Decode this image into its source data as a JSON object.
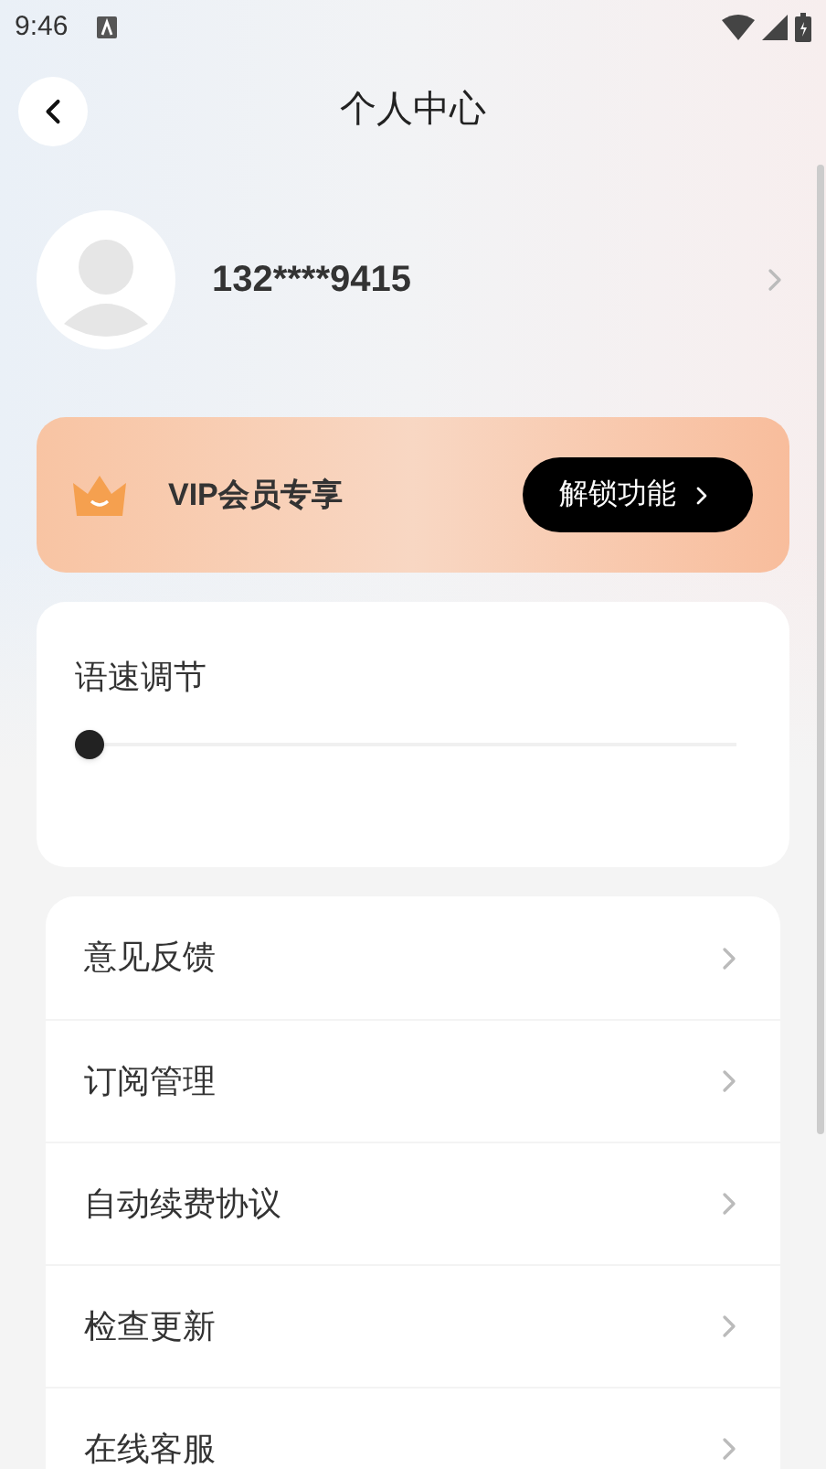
{
  "status_bar": {
    "time": "9:46"
  },
  "header": {
    "title": "个人中心"
  },
  "profile": {
    "phone": "132****9415"
  },
  "vip": {
    "label": "VIP会员专享",
    "button": "解锁功能"
  },
  "speed": {
    "label": "语速调节",
    "level": 0
  },
  "menu": [
    {
      "label": "意见反馈"
    },
    {
      "label": "订阅管理"
    },
    {
      "label": "自动续费协议"
    },
    {
      "label": "检查更新"
    },
    {
      "label": "在线客服"
    }
  ]
}
